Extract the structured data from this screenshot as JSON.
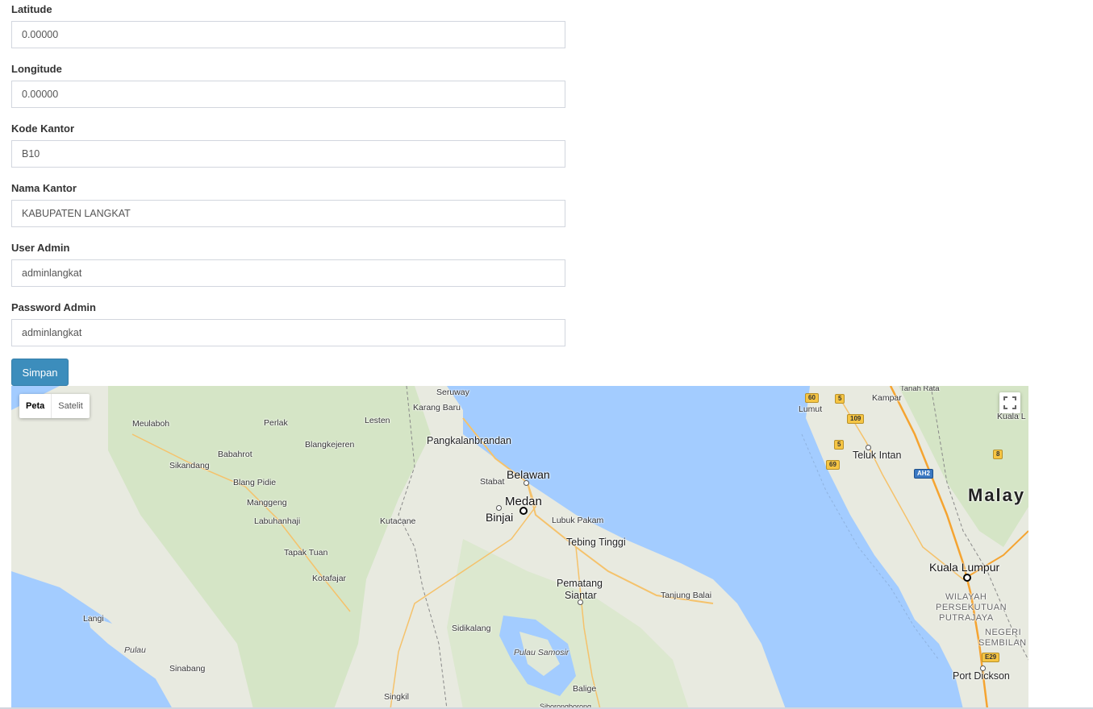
{
  "form": {
    "fields": [
      {
        "label": "Latitude",
        "value": "0.00000"
      },
      {
        "label": "Longitude",
        "value": "0.00000"
      },
      {
        "label": "Kode Kantor",
        "value": "B10"
      },
      {
        "label": "Nama Kantor",
        "value": "KABUPATEN LANGKAT"
      },
      {
        "label": "User Admin",
        "value": "adminlangkat"
      },
      {
        "label": "Password Admin",
        "value": "adminlangkat"
      }
    ],
    "submit_label": "Simpan"
  },
  "map": {
    "type_controls": {
      "map": "Peta",
      "satellite": "Satelit"
    },
    "labels": {
      "seruway": "Seruway",
      "karang_baru": "Karang Baru",
      "meulaboh": "Meulaboh",
      "perlak": "Perlak",
      "lesten": "Lesten",
      "blangkejeren": "Blangkejeren",
      "pangkalanbrandan": "Pangkalanbrandan",
      "babahrot": "Babahrot",
      "sikandang": "Sikandang",
      "belawan": "Belawan",
      "stabat": "Stabat",
      "blang_pidie": "Blang Pidie",
      "medan": "Medan",
      "manggeng": "Manggeng",
      "binjai": "Binjai",
      "labuhanhaji": "Labuhanhaji",
      "kutacane": "Kutacane",
      "lubuk_pakam": "Lubuk Pakam",
      "tebing_tinggi": "Tebing Tinggi",
      "tapak_tuan": "Tapak Tuan",
      "kotafajar": "Kotafajar",
      "pematang_siantar_1": "Pematang",
      "pematang_siantar_2": "Siantar",
      "tanjung_balai": "Tanjung Balai",
      "langi": "Langi",
      "sidikalang": "Sidikalang",
      "pulau": "Pulau",
      "pulau_samosir": "Pulau Samosir",
      "sinabang": "Sinabang",
      "balige": "Balige",
      "singkil": "Singkil",
      "sibolga": "Siborongborong",
      "tanah_rata": "Tanah Rata",
      "kampar": "Kampar",
      "lumut": "Lumut",
      "kuala_lumpur_top": "Kuala L",
      "teluk_intan": "Teluk Intan",
      "malaysia": "Malay",
      "kuala_lumpur": "Kuala Lumpur",
      "wilayah_1": "WILAYAH",
      "wilayah_2": "PERSEKUTUAN",
      "wilayah_3": "PUTRAJAYA",
      "negeri_1": "NEGERI",
      "negeri_2": "SEMBILAN",
      "port_dickson": "Port Dickson"
    },
    "shields": {
      "r60": "60",
      "r5a": "5",
      "r109": "109",
      "r5b": "5",
      "r69": "69",
      "ah2": "AH2",
      "r8": "8",
      "e29": "E29"
    },
    "colors": {
      "sea": "#a3ccff",
      "land": "#e8eae0",
      "forest": "#cfe3bf",
      "road": "#f5c26b"
    }
  }
}
